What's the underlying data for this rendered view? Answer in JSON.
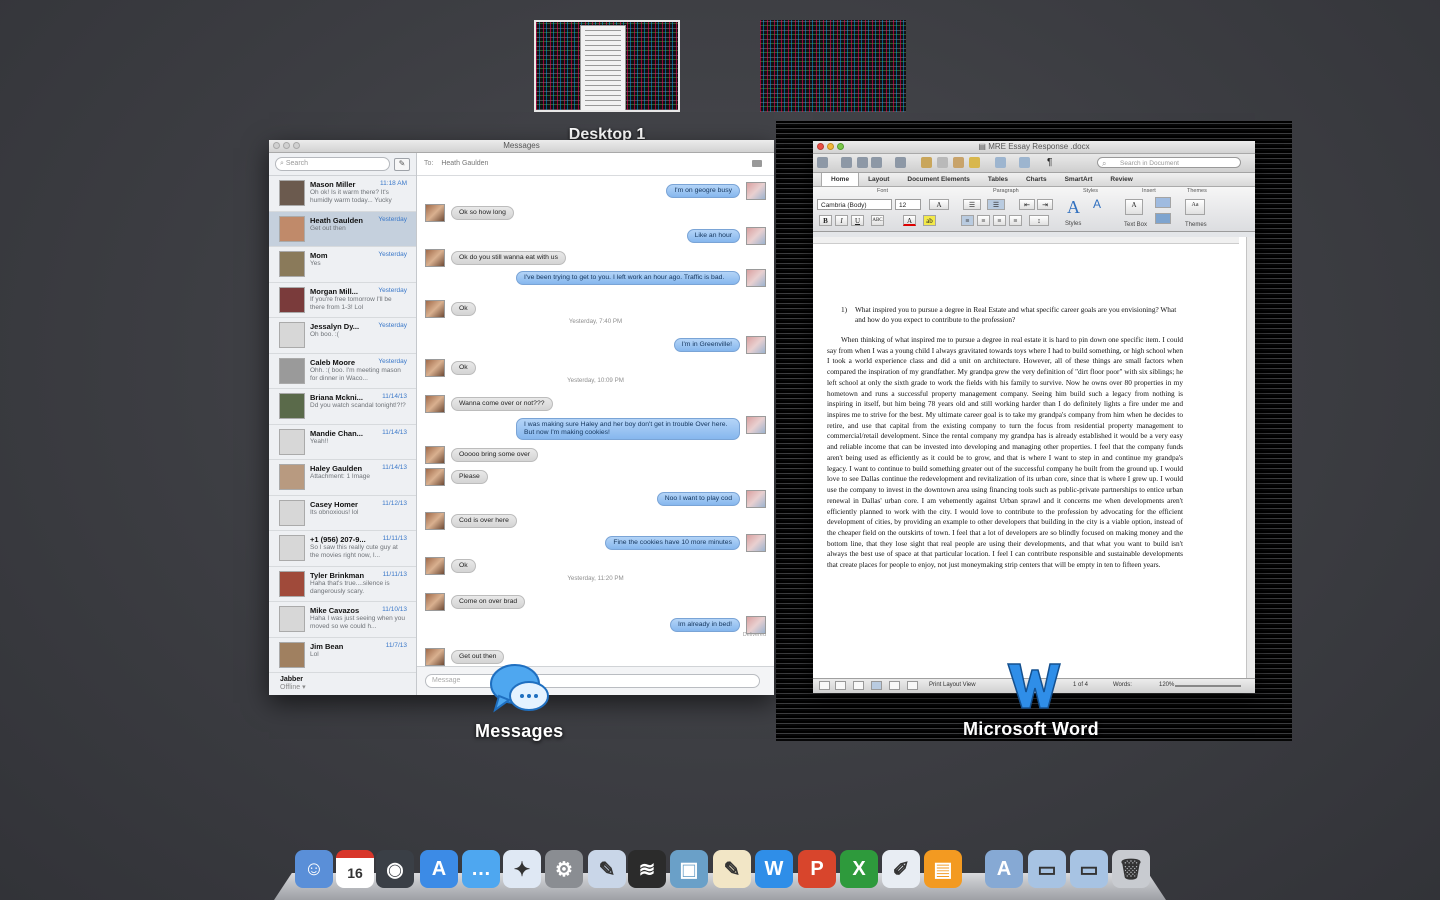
{
  "spaces": [
    {
      "label": "Desktop 1",
      "active": true
    },
    {
      "label": "",
      "active": false
    }
  ],
  "messages": {
    "window_title": "Messages",
    "search_placeholder": "Search",
    "to_label": "To:",
    "to_name": "Heath Gaulden",
    "input_placeholder": "Message",
    "app_label": "Messages",
    "conversations": [
      {
        "name": "Mason Miller",
        "time": "11:18 AM",
        "preview": "Oh ok! Is it warm there? It's humidly warm today... Yucky"
      },
      {
        "name": "Heath Gaulden",
        "time": "Yesterday",
        "preview": "Get out then"
      },
      {
        "name": "Mom",
        "time": "Yesterday",
        "preview": "Yes"
      },
      {
        "name": "Morgan Mill...",
        "time": "Yesterday",
        "preview": "If you're free tomorrow I'll be there from 1-3! Lol"
      },
      {
        "name": "Jessalyn Dy...",
        "time": "Yesterday",
        "preview": "Oh boo. :("
      },
      {
        "name": "Caleb Moore",
        "time": "Yesterday",
        "preview": "Ohh. :( boo. I'm meeting mason for dinner in Waco..."
      },
      {
        "name": "Briana Mckni...",
        "time": "11/14/13",
        "preview": "Dd you watch scandal tonight!?!?"
      },
      {
        "name": "Mandie Chan...",
        "time": "11/14/13",
        "preview": "Yeah!!"
      },
      {
        "name": "Haley Gaulden",
        "time": "11/14/13",
        "preview": "Attachment: 1 Image"
      },
      {
        "name": "Casey Homer",
        "time": "11/12/13",
        "preview": "Its obnoxious! lol"
      },
      {
        "name": "+1 (956) 207-9...",
        "time": "11/11/13",
        "preview": "So I saw this really cute guy at the movies right now, I..."
      },
      {
        "name": "Tyler Brinkman",
        "time": "11/11/13",
        "preview": "Haha that's true....silence is dangerously scary."
      },
      {
        "name": "Mike Cavazos",
        "time": "11/10/13",
        "preview": "Haha I was just seeing when you moved so we could h..."
      },
      {
        "name": "Jim Bean",
        "time": "11/7/13",
        "preview": "Lol"
      }
    ],
    "jabber": {
      "label": "Jabber",
      "status": "Offline"
    },
    "thread": [
      {
        "dir": "out",
        "text": "I'm on geogre busy"
      },
      {
        "dir": "in",
        "text": "Ok so how long"
      },
      {
        "dir": "out",
        "text": "Like an hour"
      },
      {
        "dir": "in",
        "text": "Ok do you still wanna eat with us"
      },
      {
        "dir": "out",
        "text": "I've been trying to get to you. I left work an hour ago. Traffic is bad."
      },
      {
        "dir": "in",
        "text": "Ok"
      },
      {
        "dir": "stamp",
        "text": "Yesterday, 7:40 PM"
      },
      {
        "dir": "out",
        "text": "I'm in Greenville!"
      },
      {
        "dir": "in",
        "text": "Ok"
      },
      {
        "dir": "stamp",
        "text": "Yesterday, 10:09 PM"
      },
      {
        "dir": "in",
        "text": "Wanna come over or not???"
      },
      {
        "dir": "out",
        "text": "I was making sure Haley and her boy don't get in trouble Over here. But now I'm making cookies!"
      },
      {
        "dir": "in",
        "text": "Ooooo bring some over"
      },
      {
        "dir": "in",
        "text": "Please"
      },
      {
        "dir": "out",
        "text": "Noo I want to play cod"
      },
      {
        "dir": "in",
        "text": "Cod is over here"
      },
      {
        "dir": "out",
        "text": "Fine the cookies have 10 more minutes"
      },
      {
        "dir": "in",
        "text": "Ok"
      },
      {
        "dir": "stamp",
        "text": "Yesterday, 11:20 PM"
      },
      {
        "dir": "in",
        "text": "Come on over brad"
      },
      {
        "dir": "out",
        "text": "Im already in bed!"
      },
      {
        "dir": "delivered",
        "text": "Delivered"
      },
      {
        "dir": "in",
        "text": "Get out then"
      }
    ]
  },
  "word": {
    "window_title": "MRE Essay Response .docx",
    "search_placeholder": "Search in Document",
    "tabs": [
      "Home",
      "Layout",
      "Document Elements",
      "Tables",
      "Charts",
      "SmartArt",
      "Review"
    ],
    "groups": {
      "font": "Font",
      "paragraph": "Paragraph",
      "styles": "Styles",
      "insert": "Insert",
      "themes": "Themes"
    },
    "font_name": "Cambria (Body)",
    "font_size": "12",
    "styles_label": "Styles",
    "textbox_label": "Text Box",
    "themes_label": "Themes",
    "question_num": "1)",
    "question": "What inspired you to pursue a degree in Real Estate and what specific career goals are you envisioning? What and how do you expect to contribute to the profession?",
    "body": "When thinking of what inspired me to pursue a degree in real estate it is hard to pin down one specific item. I could say from when I was a young child I always gravitated towards toys where I had to build something, or high school when I took a world experience class and did a unit on architecture. However, all of these things are small factors when compared the inspiration of my grandfather. My grandpa grew the very definition of \"dirt floor poor\" with six siblings; he left school at only the sixth grade to work the fields with his family to survive. Now he owns over 80 properties in my hometown and runs a successful property management company. Seeing him build such a legacy from nothing is inspiring in itself, but him being 78 years old and still working harder than I do definitely lights a fire under me and inspires me to strive for the best. My ultimate career goal is to take my grandpa's company from him when he decides to retire, and use that capital from the existing company to turn the focus from residential property management to commercial/retail development.  Since the rental company my grandpa has is already established it would be a very easy and reliable income that can be invested into developing and managing other properties. I feel that the company funds aren't being used as efficiently as it could be to grow, and that is where I want to step in and continue my grandpa's legacy. I want to continue to build something greater out of the successful company he built from the ground up. I would love to see Dallas continue the redevelopment and revitalization of its urban core, since that is where I grew up. I would use the company to invest in the downtown area using financing tools such as public-private partnerships to entice urban renewal in Dallas' urban core. I am vehemently against Urban sprawl and it concerns me when developments aren't efficiently planned to work with the city. I would love to contribute to the profession by advocating for the efficient development of cities, by providing an example to other developers that building in the city is a viable option, instead of the cheaper field on the outskirts of town. I feel that a lot of developers are so blindly focused on making money and the bottom line, that they lose sight that real people are using their developments, and that what you want to build isn't always the best use of space at that particular location. I feel I can contribute responsible and sustainable developments that create places for people to enjoy, not just moneymaking strip centers that will be empty in ten to fifteen years.",
    "status": {
      "view": "Print Layout View",
      "page": "1 of 4",
      "words_label": "Words:",
      "zoom": "120%"
    },
    "app_label": "Microsoft Word"
  },
  "dock": [
    "Finder",
    "Calendar",
    "FaceTime",
    "App Store",
    "Messages",
    "Safari",
    "System Preferences",
    "Preview",
    "Spotify",
    "iPhoto",
    "TextEdit",
    "Microsoft Word",
    "Microsoft PowerPoint",
    "Microsoft Excel",
    "Script Editor",
    "iBooks",
    "Applications",
    "Documents",
    "Downloads",
    "Trash"
  ],
  "calendar_day": "16"
}
